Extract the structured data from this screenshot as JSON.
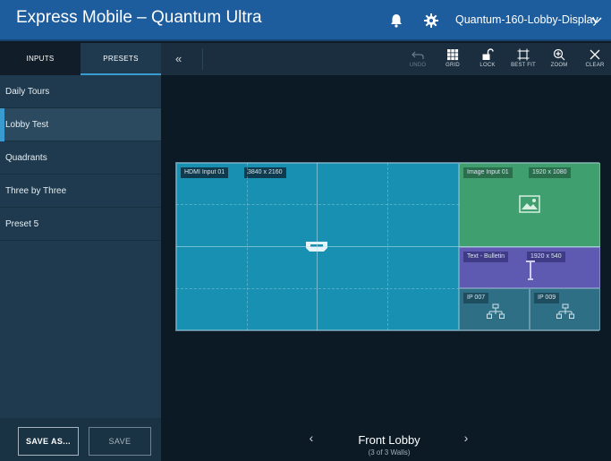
{
  "header": {
    "title": "Express Mobile – Quantum Ultra",
    "device": "Quantum-160-Lobby-Display",
    "icons": [
      "bell-icon",
      "gear-icon",
      "chevron-down-icon"
    ]
  },
  "sidebar": {
    "tabs": [
      {
        "label": "INPUTS"
      },
      {
        "label": "PRESETS"
      }
    ],
    "active_tab": "PRESETS",
    "presets": [
      {
        "label": "Daily Tours"
      },
      {
        "label": "Lobby Test"
      },
      {
        "label": "Quadrants"
      },
      {
        "label": "Three by Three"
      },
      {
        "label": "Preset 5"
      }
    ],
    "active_preset": "Lobby Test",
    "save_as_label": "SAVE AS...",
    "save_label": "SAVE"
  },
  "toolbar": {
    "collapse_glyph": "«",
    "tools": [
      {
        "label": "UNDO",
        "icon": "undo-icon",
        "enabled": false
      },
      {
        "label": "GRID",
        "icon": "grid-icon",
        "enabled": true
      },
      {
        "label": "LOCK",
        "icon": "unlock-icon",
        "enabled": true
      },
      {
        "label": "BEST FIT",
        "icon": "best-fit-icon",
        "enabled": true
      },
      {
        "label": "ZOOM",
        "icon": "zoom-icon",
        "enabled": true
      },
      {
        "label": "CLEAR",
        "icon": "close-icon",
        "enabled": true
      }
    ]
  },
  "canvas": {
    "windows": [
      {
        "name": "HDMI Input 01",
        "resolution": "3840 x 2160",
        "icon": "hdmi-icon",
        "color": "#1790b1"
      },
      {
        "name": "Image Input 01",
        "resolution": "1920 x 1080",
        "icon": "image-icon",
        "color": "#3f9f6e"
      },
      {
        "name": "Text - Bulletin",
        "resolution": "1920 x 540",
        "icon": "text-cursor-icon",
        "color": "#5e5ab2"
      },
      {
        "name": "IP 007",
        "icon": "network-icon",
        "color": "#2f6f86"
      },
      {
        "name": "IP 009",
        "icon": "network-icon",
        "color": "#2f6f86"
      }
    ]
  },
  "footer": {
    "prev_glyph": "‹",
    "next_glyph": "›",
    "wall_name": "Front Lobby",
    "wall_count": "(3 of 3 Walls)"
  }
}
